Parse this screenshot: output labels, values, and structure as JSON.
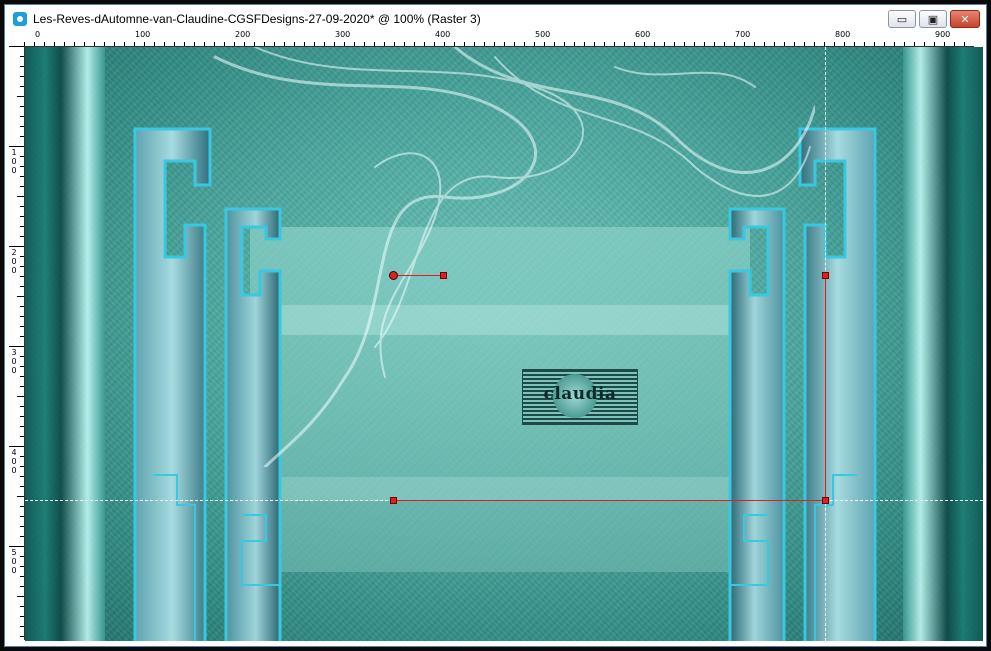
{
  "window": {
    "title": "Les-Reves-dAutomne-van-Claudine-CGSFDesigns-27-09-2020* @ 100% (Raster 3)",
    "app_icon": "camera-icon",
    "buttons": {
      "minimize": "▭",
      "maximize": "▣",
      "close": "✕"
    }
  },
  "ruler_top": {
    "labels": [
      "0",
      "100",
      "200",
      "300",
      "400",
      "500",
      "600",
      "700",
      "800",
      "900"
    ]
  },
  "ruler_left": {
    "labels": [
      "1\n0\n0",
      "2\n0\n0",
      "3\n0\n0",
      "4\n0\n0",
      "5\n0\n0"
    ]
  },
  "canvas": {
    "watermark_text": "claudia",
    "colors": {
      "background": "#4aa79e",
      "frame_accent": "#35c7de",
      "guide_line": "#e02020",
      "selection_handle": "#e02020"
    }
  }
}
